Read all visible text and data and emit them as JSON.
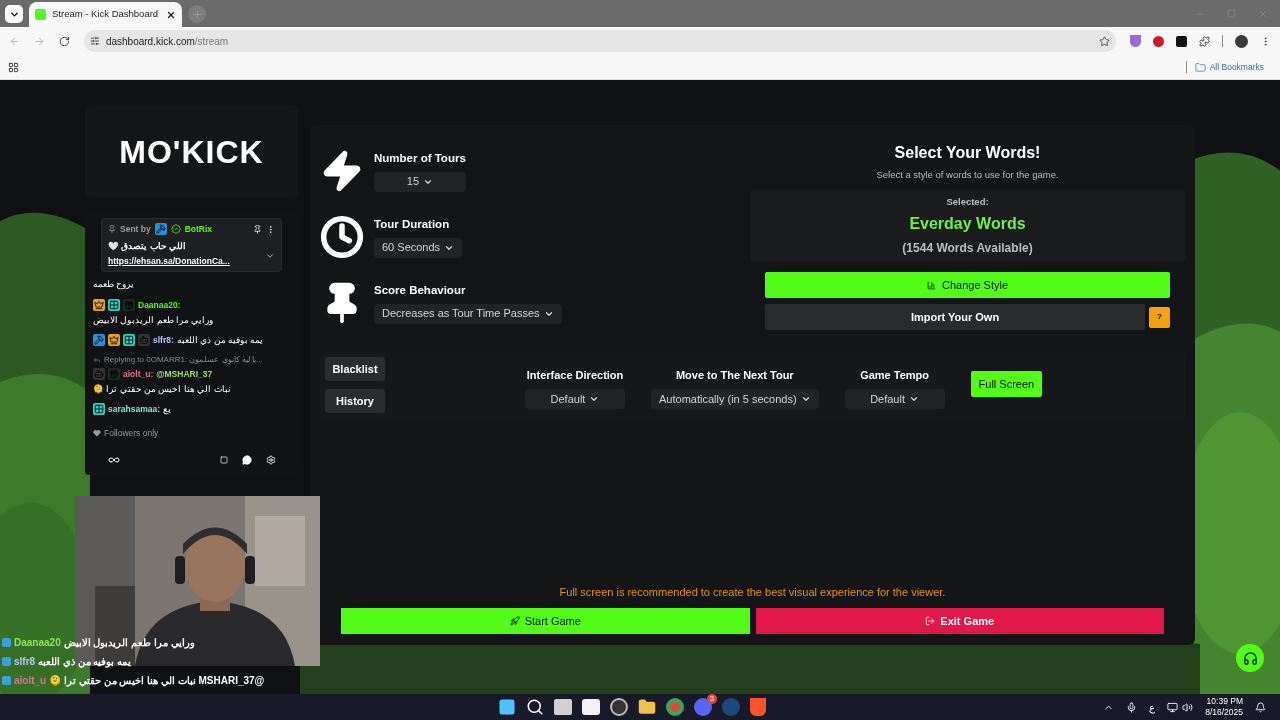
{
  "browser": {
    "tab_title": "Stream - Kick Dashboard",
    "url_host": "dashboard.kick.com",
    "url_path": "/stream",
    "bookmarks_label": "All Bookmarks"
  },
  "logo": "MO'KICK",
  "chat": {
    "pinned": {
      "sent_by": "Sent by",
      "author": "BotRix",
      "text": "اللي حاب يتصدق 🤍",
      "link": "https://ehsan.sa/DonationCa..."
    },
    "messages": [
      {
        "kind": "continuation",
        "text": "يروح طعمه"
      },
      {
        "kind": "message",
        "badges": [
          {
            "kind": "crown"
          },
          {
            "kind": "grid"
          },
          {
            "kind": "gift"
          }
        ],
        "user": "Daanaa20:",
        "color": "#53fc18",
        "text": "ورايي مرا طعم الريدبول الابيض"
      },
      {
        "kind": "message",
        "badges": [
          {
            "kind": "hammer"
          },
          {
            "kind": "crown"
          },
          {
            "kind": "grid"
          },
          {
            "kind": "bot"
          }
        ],
        "user": "slfr8:",
        "color": "#b6c4ff",
        "text": "يمه بوفيه من ذي اللعبه"
      },
      {
        "kind": "reply",
        "text": "Replying to 0OMARR1: يا ليه كانوي عسلمون..."
      },
      {
        "kind": "message",
        "badges": [
          {
            "kind": "bot"
          },
          {
            "kind": "gift"
          }
        ],
        "user": "aiolt_u:",
        "color": "#e0708e",
        "mention": "@MSHARI_37",
        "text": "نبات الي هنا اخيس من حقتي ترا 🫠"
      },
      {
        "kind": "message",
        "badges": [
          {
            "kind": "grid"
          }
        ],
        "user": "sarahsamaa:",
        "color": "#7fe8d0",
        "text": "بع"
      }
    ],
    "mode": "Followers only"
  },
  "settings": [
    {
      "kind": "bolt",
      "label": "Number of Tours",
      "value": "15"
    },
    {
      "kind": "clock",
      "label": "Tour Duration",
      "value": "60 Seconds"
    },
    {
      "kind": "pin",
      "label": "Score Behaviour",
      "value": "Decreases as Tour Time Passes"
    }
  ],
  "words": {
    "title": "Select Your Words!",
    "subtitle": "Select a style of words to use for the game.",
    "selected_label": "Selected:",
    "selected": "Everday Words",
    "count": "(1544 Words Available)",
    "change_button": "Change Style",
    "import_button": "Import Your Own",
    "help_button": "?"
  },
  "side_buttons": [
    "Blacklist",
    "History"
  ],
  "options": [
    {
      "label": "Interface Direction",
      "value": "Default"
    },
    {
      "label": "Move to The Next Tour",
      "value": "Automatically (in 5 seconds)"
    },
    {
      "label": "Game Tempo",
      "value": "Default"
    }
  ],
  "fullscreen_button": "Full Screen",
  "notice": "Full screen is recommended to create the best visual experience for the viewer.",
  "start_button": "Start Game",
  "exit_button": "Exit Game",
  "overlay_chat": [
    {
      "user": "Daanaa20",
      "color": "#8ee84a",
      "text": "ورايي مرا طعم الريدبول الابيض"
    },
    {
      "user": "slfr8",
      "color": "#b6c4ff",
      "text": "يمه بوفيه من ذي اللعبه"
    },
    {
      "user": "aiolt_u",
      "color": "#e0708e",
      "text": "@MSHARI_37 نبات الي هنا اخيس من حقتي ترا 🫠"
    }
  ],
  "taskbar": {
    "input_language": "ع",
    "time": "10:39 PM",
    "date": "8/16/2025",
    "discord_badge": "3"
  }
}
